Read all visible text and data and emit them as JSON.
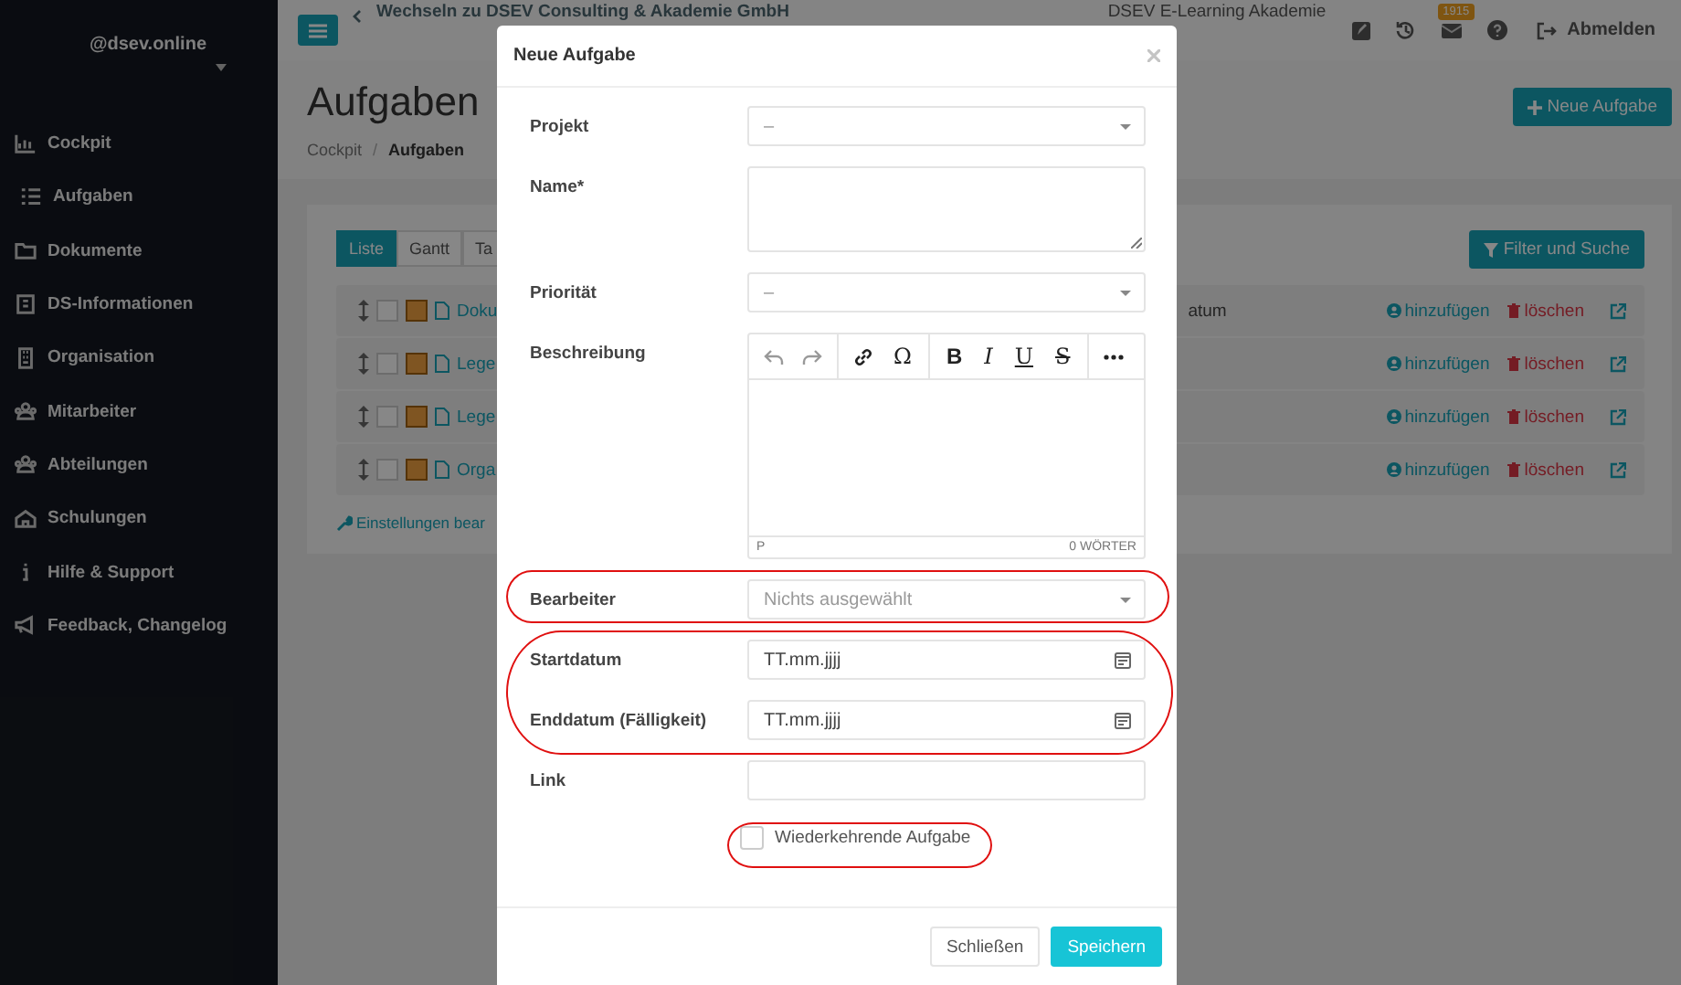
{
  "sidebar": {
    "account": "@dsev.online",
    "items": [
      {
        "label": "Cockpit"
      },
      {
        "label": "Aufgaben"
      },
      {
        "label": "Dokumente"
      },
      {
        "label": "DS-Informationen"
      },
      {
        "label": "Organisation"
      },
      {
        "label": "Mitarbeiter"
      },
      {
        "label": "Abteilungen"
      },
      {
        "label": "Schulungen"
      },
      {
        "label": "Hilfe & Support"
      },
      {
        "label": "Feedback, Changelog"
      }
    ]
  },
  "topbar": {
    "switch_link": "Wechseln zu DSEV Consulting & Akademie GmbH",
    "organization": "DSEV E-Learning Akademie",
    "mail_badge": "1915",
    "logout": "Abmelden"
  },
  "page": {
    "title": "Aufgaben",
    "breadcrumb": [
      "Cockpit",
      "Aufgaben"
    ],
    "breadcrumb_separator": "/",
    "new_button": "Neue Aufgabe"
  },
  "view_tabs": [
    {
      "label": "Liste",
      "selected": true
    },
    {
      "label": "Gantt",
      "selected": false
    },
    {
      "label": "Ta",
      "selected": false
    }
  ],
  "filter_button": "Filter und Suche",
  "tasks": [
    {
      "checked": false,
      "name": "Doku",
      "column_3": "atum",
      "add": "hinzufügen",
      "delete": "löschen"
    },
    {
      "checked": false,
      "name": "Lege",
      "add": "hinzufügen",
      "delete": "löschen"
    },
    {
      "checked": false,
      "name": "Lege",
      "add": "hinzufügen",
      "delete": "löschen"
    },
    {
      "checked": false,
      "name": "Orga",
      "add": "hinzufügen",
      "delete": "löschen"
    }
  ],
  "settings_link": "Einstellungen bear",
  "modal": {
    "title": "Neue Aufgabe",
    "fields": [
      {
        "kind": "select",
        "label": "Projekt",
        "value": "–"
      },
      {
        "kind": "textarea",
        "label": "Name*"
      },
      {
        "kind": "select",
        "label": "Priorität",
        "value": "–"
      },
      {
        "kind": "editor",
        "label": "Beschreibung",
        "toolbar": [
          {
            "glyph": "Ω",
            "kind": "plain"
          },
          {
            "glyph": "B",
            "kind": "bold"
          },
          {
            "glyph": "I",
            "kind": "italic"
          },
          {
            "glyph": "U",
            "kind": "underline"
          },
          {
            "glyph": "S",
            "kind": "strike"
          }
        ],
        "status_left": "P",
        "status_right": "0 WÖRTER"
      },
      {
        "kind": "select",
        "label": "Bearbeiter",
        "placeholder": "Nichts ausgewählt"
      },
      {
        "kind": "date",
        "label": "Startdatum",
        "placeholder": "TT.mm.jjjj"
      },
      {
        "kind": "date",
        "label": "Enddatum (Fälligkeit)",
        "placeholder": "TT.mm.jjjj"
      },
      {
        "kind": "text",
        "label": "Link"
      }
    ],
    "recurring": {
      "label": "Wiederkehrende Aufgabe",
      "checked": false
    },
    "buttons": [
      {
        "label": "Schließen",
        "kind": "secondary"
      },
      {
        "label": "Speichern",
        "kind": "primary"
      }
    ]
  }
}
